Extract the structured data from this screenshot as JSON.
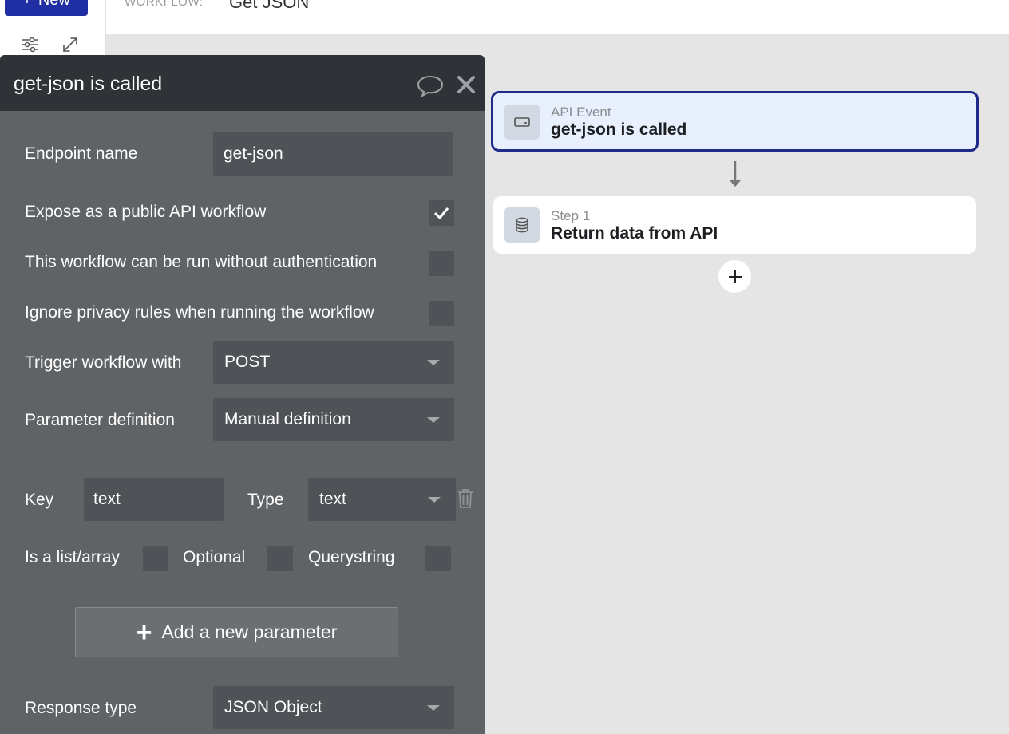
{
  "topbar": {
    "new_label": "New",
    "workflow_label": "WORKFLOW:",
    "workflow_name": "Get JSON"
  },
  "panel": {
    "title": "get-json is called",
    "endpoint_label": "Endpoint name",
    "endpoint_value": "get-json",
    "expose_label": "Expose as a public API workflow",
    "expose_checked": true,
    "no_auth_label": "This workflow can be run without authentication",
    "no_auth_checked": false,
    "ignore_privacy_label": "Ignore privacy rules when running the workflow",
    "ignore_privacy_checked": false,
    "trigger_label": "Trigger workflow with",
    "trigger_value": "POST",
    "param_def_label": "Parameter definition",
    "param_def_value": "Manual definition",
    "parameter": {
      "key_label": "Key",
      "key_value": "text",
      "type_label": "Type",
      "type_value": "text",
      "is_list_label": "Is a list/array",
      "optional_label": "Optional",
      "querystring_label": "Querystring"
    },
    "add_param_label": "Add a new parameter",
    "response_label": "Response type",
    "response_value": "JSON Object"
  },
  "canvas": {
    "event_kicker": "API Event",
    "event_title": "get-json is called",
    "step_kicker": "Step 1",
    "step_title": "Return data from API"
  },
  "colors": {
    "accent": "#1f2fa3",
    "panel_bg": "#606366",
    "panel_header": "#2f3236",
    "field_bg": "#4f5256",
    "event_card_bg": "#e8f0fd",
    "event_card_border": "#1f2a8a"
  }
}
